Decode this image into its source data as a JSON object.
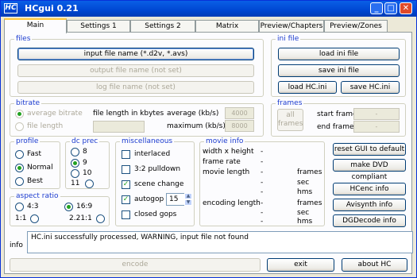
{
  "app": {
    "title": "HCgui 0.21",
    "logo": "HC"
  },
  "window_controls": {
    "minimize": "_",
    "maximize": "□",
    "close": "✕"
  },
  "tabs": [
    {
      "label": "Main",
      "active": true
    },
    {
      "label": "Settings 1"
    },
    {
      "label": "Settings 2"
    },
    {
      "label": "Matrix"
    },
    {
      "label": "Preview/Chapters"
    },
    {
      "label": "Preview/Zones"
    }
  ],
  "files": {
    "title": "files",
    "input_button": "input file name (*.d2v, *.avs)",
    "output_button": "output file name (not set)",
    "log_button": "log file name (not set)"
  },
  "ini_file": {
    "title": "ini file",
    "load_ini": "load ini file",
    "save_ini": "save ini file",
    "load_hc": "load HC.ini",
    "save_hc": "save HC.ini"
  },
  "bitrate": {
    "title": "bitrate",
    "average_bitrate": "average bitrate",
    "file_length": "file length",
    "file_length_kbytes": "file length in kbytes",
    "average_label": "average (kb/s)",
    "average_value": "4000",
    "maximum_label": "maximum (kb/s)",
    "maximum_value": "8000"
  },
  "frames": {
    "title": "frames",
    "all_frames": "all\nframes",
    "start_frame": "start frame",
    "end_frame": "end frame",
    "start_value": "-",
    "end_value": "-"
  },
  "profile": {
    "title": "profile",
    "options": [
      "Fast",
      "Normal",
      "Best"
    ],
    "selected": "Normal"
  },
  "dc_prec": {
    "title": "dc prec",
    "options": [
      "8",
      "9",
      "10",
      "11"
    ],
    "selected": "9"
  },
  "aspect_ratio": {
    "title": "aspect ratio",
    "options": [
      "4:3",
      "16:9",
      "1:1",
      "2.21:1"
    ],
    "selected": "16:9"
  },
  "miscellaneous": {
    "title": "miscellaneous",
    "interlaced": "interlaced",
    "pulldown": "3:2 pulldown",
    "scene_change": "scene change",
    "autogop": "autogop",
    "autogop_value": "15",
    "closed_gops": "closed gops"
  },
  "movie_info": {
    "title": "movie info",
    "width_height": "width x height",
    "frame_rate": "frame rate",
    "movie_length": "movie length",
    "encoding_length": "encoding length",
    "dash": "-",
    "unit_frames": "frames",
    "unit_sec": "sec",
    "unit_hms": "hms"
  },
  "right_buttons": {
    "reset": "reset GUI to default",
    "dvd": "make DVD compliant",
    "hcenc": "HCenc info",
    "avisynth": "Avisynth info",
    "dgdecode": "DGDecode info"
  },
  "info": {
    "label": "info",
    "message": "HC.ini successfully processed, WARNING, input file not found"
  },
  "bottom": {
    "encode": "encode",
    "exit": "exit",
    "about": "about HC"
  }
}
